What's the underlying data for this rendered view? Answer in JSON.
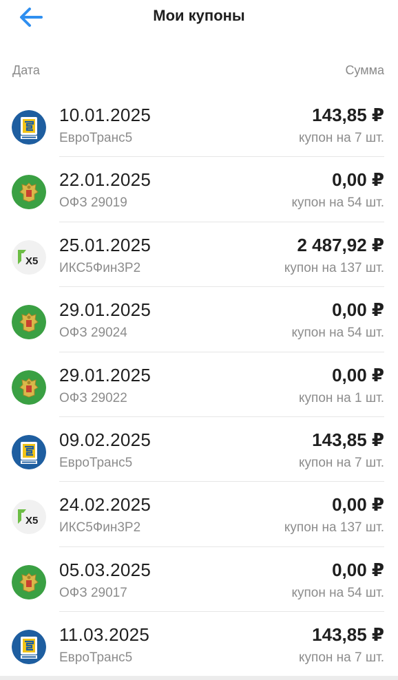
{
  "header": {
    "title": "Мои купоны"
  },
  "columns": {
    "date": "Дата",
    "sum": "Сумма"
  },
  "colors": {
    "accent": "#2f8ff0",
    "ofz_green": "#3aa043",
    "eurotrans_blue": "#1e5ea0",
    "x5_green": "#6cbd45"
  },
  "coupons": [
    {
      "logo": "eurotrans-logo",
      "date": "10.01.2025",
      "name": "ЕвроТранс5",
      "amount": "143,85 ₽",
      "qty": "купон на 7 шт."
    },
    {
      "logo": "ofz-emblem-logo",
      "date": "22.01.2025",
      "name": "ОФЗ 29019",
      "amount": "0,00 ₽",
      "qty": "купон на 54 шт."
    },
    {
      "logo": "x5-logo",
      "date": "25.01.2025",
      "name": "ИКС5Фин3Р2",
      "amount": "2 487,92 ₽",
      "qty": "купон на 137 шт."
    },
    {
      "logo": "ofz-emblem-logo",
      "date": "29.01.2025",
      "name": "ОФЗ 29024",
      "amount": "0,00 ₽",
      "qty": "купон на 54 шт."
    },
    {
      "logo": "ofz-emblem-logo",
      "date": "29.01.2025",
      "name": "ОФЗ 29022",
      "amount": "0,00 ₽",
      "qty": "купон на 1 шт."
    },
    {
      "logo": "eurotrans-logo",
      "date": "09.02.2025",
      "name": "ЕвроТранс5",
      "amount": "143,85 ₽",
      "qty": "купон на 7 шт."
    },
    {
      "logo": "x5-logo",
      "date": "24.02.2025",
      "name": "ИКС5Фин3Р2",
      "amount": "0,00 ₽",
      "qty": "купон на 137 шт."
    },
    {
      "logo": "ofz-emblem-logo",
      "date": "05.03.2025",
      "name": "ОФЗ 29017",
      "amount": "0,00 ₽",
      "qty": "купон на 54 шт."
    },
    {
      "logo": "eurotrans-logo",
      "date": "11.03.2025",
      "name": "ЕвроТранс5",
      "amount": "143,85 ₽",
      "qty": "купон на 7 шт."
    }
  ]
}
